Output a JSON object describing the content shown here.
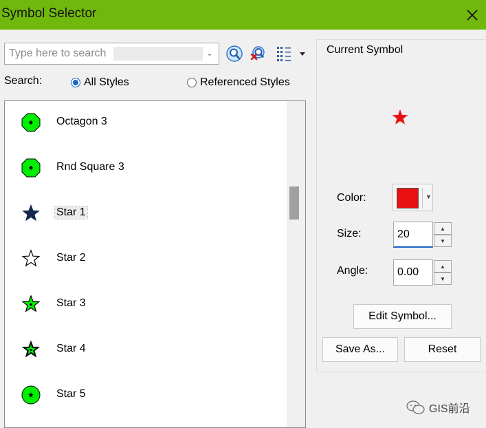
{
  "window": {
    "title": "Symbol Selector"
  },
  "search": {
    "placeholder": "Type here to search",
    "value": "",
    "label": "Search:"
  },
  "toolbar": {
    "search_icon": "magnifier-icon",
    "clear_icon": "clear-search-icon",
    "view_icon": "view-list-icon"
  },
  "scope": {
    "options": [
      {
        "label": "All Styles",
        "selected": true
      },
      {
        "label": "Referenced Styles",
        "selected": false
      }
    ]
  },
  "symbols": [
    {
      "label": "Octagon 3",
      "icon": "green-octagon-icon"
    },
    {
      "label": "Rnd Square 3",
      "icon": "green-rounded-square-icon"
    },
    {
      "label": "Star 1",
      "icon": "navy-star-icon",
      "selected": true
    },
    {
      "label": "Star 2",
      "icon": "white-star-icon"
    },
    {
      "label": "Star 3",
      "icon": "green-star-icon"
    },
    {
      "label": "Star 4",
      "icon": "green-star-outline-icon"
    },
    {
      "label": "Star 5",
      "icon": "green-circle-star-icon"
    }
  ],
  "current_symbol": {
    "title": "Current Symbol",
    "color_label": "Color:",
    "color": "#e81010",
    "size_label": "Size:",
    "size": "20",
    "angle_label": "Angle:",
    "angle": "0.00"
  },
  "buttons": {
    "edit": "Edit Symbol...",
    "save_as": "Save As...",
    "reset": "Reset"
  },
  "watermark": "GIS前沿",
  "colors": {
    "titlebar": "#71b80d",
    "symbol_green": "#00ee00",
    "star_navy": "#14284f",
    "accent": "#1668c8"
  }
}
